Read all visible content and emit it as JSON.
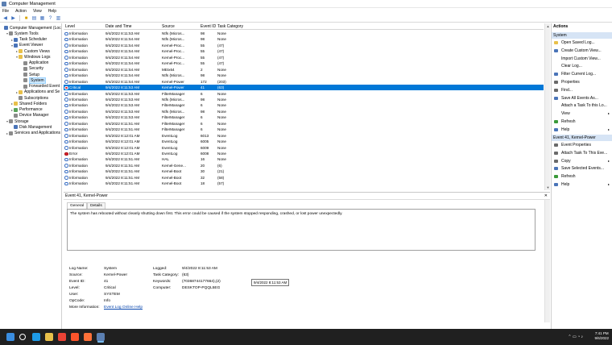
{
  "window": {
    "title": "Computer Management"
  },
  "menu": [
    "File",
    "Action",
    "View",
    "Help"
  ],
  "tree": [
    {
      "label": "Computer Management (Local",
      "indent": 0,
      "toggle": "",
      "icon": "computer-icon",
      "selected": false
    },
    {
      "label": "System Tools",
      "indent": 1,
      "toggle": "v",
      "icon": "tools-icon",
      "selected": false
    },
    {
      "label": "Task Scheduler",
      "indent": 2,
      "toggle": ">",
      "icon": "clock-icon",
      "selected": false
    },
    {
      "label": "Event Viewer",
      "indent": 2,
      "toggle": "v",
      "icon": "event-viewer-icon",
      "selected": false
    },
    {
      "label": "Custom Views",
      "indent": 3,
      "toggle": ">",
      "icon": "folder-icon",
      "selected": false
    },
    {
      "label": "Windows Logs",
      "indent": 3,
      "toggle": "v",
      "icon": "folder-icon",
      "selected": false
    },
    {
      "label": "Application",
      "indent": 4,
      "toggle": "",
      "icon": "log-icon",
      "selected": false
    },
    {
      "label": "Security",
      "indent": 4,
      "toggle": "",
      "icon": "log-icon",
      "selected": false
    },
    {
      "label": "Setup",
      "indent": 4,
      "toggle": "",
      "icon": "log-icon",
      "selected": false
    },
    {
      "label": "System",
      "indent": 4,
      "toggle": "",
      "icon": "log-icon",
      "selected": true
    },
    {
      "label": "Forwarded Event",
      "indent": 4,
      "toggle": "",
      "icon": "log-icon",
      "selected": false
    },
    {
      "label": "Applications and Se",
      "indent": 3,
      "toggle": ">",
      "icon": "folder-icon",
      "selected": false
    },
    {
      "label": "Subscriptions",
      "indent": 3,
      "toggle": "",
      "icon": "subscription-icon",
      "selected": false
    },
    {
      "label": "Shared Folders",
      "indent": 2,
      "toggle": ">",
      "icon": "folder-icon",
      "selected": false
    },
    {
      "label": "Performance",
      "indent": 2,
      "toggle": ">",
      "icon": "performance-icon",
      "selected": false
    },
    {
      "label": "Device Manager",
      "indent": 2,
      "toggle": "",
      "icon": "device-manager-icon",
      "selected": false
    },
    {
      "label": "Storage",
      "indent": 1,
      "toggle": "v",
      "icon": "storage-icon",
      "selected": false
    },
    {
      "label": "Disk Management",
      "indent": 2,
      "toggle": "",
      "icon": "disk-icon",
      "selected": false
    },
    {
      "label": "Services and Applications",
      "indent": 1,
      "toggle": ">",
      "icon": "services-icon",
      "selected": false
    }
  ],
  "events": {
    "columns": [
      "Level",
      "Date and Time",
      "Source",
      "Event ID",
      "Task Category"
    ],
    "rows": [
      {
        "level": "Information",
        "date": "9/4/2022 8:11:53 AM",
        "source": "Ntfs (Micros...",
        "id": "98",
        "task": "None",
        "sel": false
      },
      {
        "level": "Information",
        "date": "9/4/2022 8:11:54 AM",
        "source": "Ntfs (Micros...",
        "id": "98",
        "task": "None",
        "sel": false
      },
      {
        "level": "Information",
        "date": "9/4/2022 8:11:54 AM",
        "source": "Kernel-Proc...",
        "id": "55",
        "task": "(47)",
        "sel": false
      },
      {
        "level": "Information",
        "date": "9/4/2022 8:11:54 AM",
        "source": "Kernel-Proc...",
        "id": "55",
        "task": "(47)",
        "sel": false
      },
      {
        "level": "Information",
        "date": "9/4/2022 8:11:54 AM",
        "source": "Kernel-Proc...",
        "id": "55",
        "task": "(47)",
        "sel": false
      },
      {
        "level": "Information",
        "date": "9/4/2022 8:11:54 AM",
        "source": "Kernel-Proc...",
        "id": "55",
        "task": "(47)",
        "sel": false
      },
      {
        "level": "Information",
        "date": "9/4/2022 8:11:54 AM",
        "source": "MEIx64",
        "id": "2",
        "task": "None",
        "sel": false
      },
      {
        "level": "Information",
        "date": "9/4/2022 8:11:54 AM",
        "source": "Ntfs (Micros...",
        "id": "98",
        "task": "None",
        "sel": false
      },
      {
        "level": "Information",
        "date": "9/4/2022 8:11:54 AM",
        "source": "Kernel-Power",
        "id": "172",
        "task": "(203)",
        "sel": false
      },
      {
        "level": "Critical",
        "date": "9/4/2022 8:11:53 AM",
        "source": "Kernel-Power",
        "id": "41",
        "task": "(63)",
        "sel": true
      },
      {
        "level": "Information",
        "date": "9/4/2022 8:11:53 AM",
        "source": "FilterManager",
        "id": "6",
        "task": "None",
        "sel": false
      },
      {
        "level": "Information",
        "date": "9/4/2022 8:11:53 AM",
        "source": "Ntfs (Micros...",
        "id": "98",
        "task": "None",
        "sel": false
      },
      {
        "level": "Information",
        "date": "9/4/2022 8:11:53 AM",
        "source": "FilterManager",
        "id": "6",
        "task": "None",
        "sel": false
      },
      {
        "level": "Information",
        "date": "9/4/2022 8:11:53 AM",
        "source": "Ntfs (Micros...",
        "id": "98",
        "task": "None",
        "sel": false
      },
      {
        "level": "Information",
        "date": "9/4/2022 8:11:53 AM",
        "source": "FilterManager",
        "id": "6",
        "task": "None",
        "sel": false
      },
      {
        "level": "Information",
        "date": "9/4/2022 8:11:51 AM",
        "source": "FilterManager",
        "id": "6",
        "task": "None",
        "sel": false
      },
      {
        "level": "Information",
        "date": "9/4/2022 8:11:51 AM",
        "source": "FilterManager",
        "id": "6",
        "task": "None",
        "sel": false
      },
      {
        "level": "Information",
        "date": "9/4/2022 8:12:01 AM",
        "source": "EventLog",
        "id": "6013",
        "task": "None",
        "sel": false
      },
      {
        "level": "Information",
        "date": "9/4/2022 8:12:01 AM",
        "source": "EventLog",
        "id": "6005",
        "task": "None",
        "sel": false
      },
      {
        "level": "Information",
        "date": "9/4/2022 8:12:01 AM",
        "source": "EventLog",
        "id": "6009",
        "task": "None",
        "sel": false
      },
      {
        "level": "Error",
        "date": "9/4/2022 8:12:01 AM",
        "source": "EventLog",
        "id": "6008",
        "task": "None",
        "sel": false
      },
      {
        "level": "Information",
        "date": "9/4/2022 8:11:51 AM",
        "source": "HAL",
        "id": "16",
        "task": "None",
        "sel": false
      },
      {
        "level": "Information",
        "date": "9/4/2022 8:11:51 AM",
        "source": "Kernel-Gene...",
        "id": "20",
        "task": "(6)",
        "sel": false
      },
      {
        "level": "Information",
        "date": "9/4/2022 8:11:51 AM",
        "source": "Kernel-Boot",
        "id": "30",
        "task": "(21)",
        "sel": false
      },
      {
        "level": "Information",
        "date": "9/4/2022 8:11:51 AM",
        "source": "Kernel-Boot",
        "id": "32",
        "task": "(58)",
        "sel": false
      },
      {
        "level": "Information",
        "date": "9/4/2022 8:11:51 AM",
        "source": "Kernel-Boot",
        "id": "18",
        "task": "(57)",
        "sel": false
      }
    ]
  },
  "detail": {
    "title": "Event 41, Kernel-Power",
    "tabs": [
      "General",
      "Details"
    ],
    "description": "The system has rebooted without cleanly shutting down first. This error could be caused if the system stopped responding, crashed, or lost power unexpectedly.",
    "fields_left": [
      {
        "label": "Log Name:",
        "value": "System"
      },
      {
        "label": "Source:",
        "value": "Kernel-Power"
      },
      {
        "label": "Event ID:",
        "value": "41"
      },
      {
        "label": "Level:",
        "value": "Critical"
      },
      {
        "label": "User:",
        "value": "SYSTEM"
      },
      {
        "label": "OpCode:",
        "value": "Info"
      },
      {
        "label": "More Information:",
        "value": "Event Log Online Help"
      }
    ],
    "fields_right": [
      {
        "label": "Logged:",
        "value": "9/4/2022 8:11:53 AM"
      },
      {
        "label": "Task Category:",
        "value": "(63)"
      },
      {
        "label": "Keywords:",
        "value": "(70368744177664),(2)"
      },
      {
        "label": "Computer:",
        "value": "DESKTOP-PQQL5EG"
      }
    ],
    "tooltip": "9/4/2022 8:11:53 AM"
  },
  "actions": {
    "title": "Actions",
    "section1": "System",
    "items1": [
      {
        "label": "Open Saved Log...",
        "icon": "open-log-icon",
        "chevron": false
      },
      {
        "label": "Create Custom View...",
        "icon": "filter-create-icon",
        "chevron": false
      },
      {
        "label": "Import Custom View...",
        "icon": "",
        "chevron": false
      },
      {
        "label": "Clear Log...",
        "icon": "",
        "chevron": false
      },
      {
        "label": "Filter Current Log...",
        "icon": "filter-icon",
        "chevron": false
      },
      {
        "label": "Properties",
        "icon": "properties-icon",
        "chevron": false
      },
      {
        "label": "Find...",
        "icon": "find-icon",
        "chevron": false
      },
      {
        "label": "Save All Events As...",
        "icon": "save-icon",
        "chevron": false
      },
      {
        "label": "Attach a Task To this Lo...",
        "icon": "",
        "chevron": false
      },
      {
        "label": "View",
        "icon": "",
        "chevron": true
      },
      {
        "label": "Refresh",
        "icon": "refresh-icon",
        "chevron": false
      },
      {
        "label": "Help",
        "icon": "help-icon",
        "chevron": true
      }
    ],
    "section2": "Event 41, Kernel-Power",
    "items2": [
      {
        "label": "Event Properties",
        "icon": "properties-icon",
        "chevron": false
      },
      {
        "label": "Attach Task To This Eve...",
        "icon": "task-icon",
        "chevron": false
      },
      {
        "label": "Copy",
        "icon": "copy-icon",
        "chevron": true
      },
      {
        "label": "Save Selected Events...",
        "icon": "save-icon",
        "chevron": false
      },
      {
        "label": "Refresh",
        "icon": "refresh-icon",
        "chevron": false
      },
      {
        "label": "Help",
        "icon": "help-icon",
        "chevron": true
      }
    ]
  },
  "taskbar": {
    "time": "7:41 PM",
    "date": "9/6/2022",
    "apps": [
      "windows-start-icon",
      "search-icon",
      "edge-icon",
      "file-explorer-icon",
      "chrome-icon",
      "brave-icon",
      "firefox-icon",
      "computer-management-icon"
    ]
  }
}
